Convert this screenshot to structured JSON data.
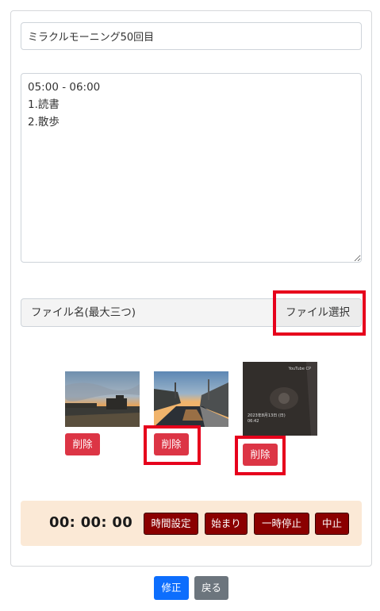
{
  "form": {
    "title_value": "ミラクルモーニング50回目",
    "memo_value": "05:00 - 06:00\n1.読書\n2.散歩",
    "file_placeholder": "ファイル名(最大三つ)",
    "file_button_label": "ファイル選択"
  },
  "images": [
    {
      "delete_label": "削除",
      "thumb_icon": "sunset-photo"
    },
    {
      "delete_label": "削除",
      "thumb_icon": "river-sunset-photo"
    },
    {
      "delete_label": "削除",
      "thumb_icon": "dark-screen-photo",
      "overlay_text_1": "2023年8月13日 (日)",
      "overlay_text_2": "06:42",
      "corner_text": "YouTube CP"
    }
  ],
  "timer": {
    "display": "00: 00: 00",
    "set_label": "時間設定",
    "start_label": "始まり",
    "pause_label": "一時停止",
    "stop_label": "中止",
    "bg_color": "#fbe9d6",
    "button_color": "#8b0000"
  },
  "footer": {
    "edit_label": "修正",
    "back_label": "戻る",
    "edit_color": "#0d6efd",
    "back_color": "#6c757d"
  },
  "colors": {
    "highlight": "#e6001c",
    "delete": "#dc3545"
  }
}
